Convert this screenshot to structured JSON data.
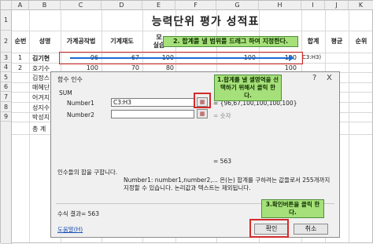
{
  "columns": [
    "A",
    "B",
    "C",
    "D",
    "E",
    "F",
    "G",
    "H",
    "I",
    "J",
    "K"
  ],
  "rows": [
    "1",
    "2",
    "3",
    "4",
    "5",
    "6",
    "7",
    "8",
    "9"
  ],
  "sheet_title": "능력단위 평가 성적표",
  "headers": {
    "seq": "순번",
    "name": "성명",
    "c": "가계공작법",
    "d": "기계재도",
    "e": "모\n실습",
    "total": "합계",
    "avg": "평균",
    "rank": "순위"
  },
  "r3": {
    "seq": "1",
    "name": "김기현",
    "c": "96",
    "d": "67",
    "e": "100",
    "g": "100",
    "h": "100",
    "total_formula": "C3:H3)"
  },
  "r4": {
    "seq": "2",
    "name": "호기수",
    "c": "100",
    "d": "70",
    "e": "80",
    "h": "100"
  },
  "names": {
    "r5": "김정스",
    "r6": "매혜단",
    "r7": "어겨지",
    "r8": "성지수",
    "r9": "박성지",
    "total": "총 계"
  },
  "callout2": "2. 합계를 낼 범위를 드래그 하여 지정한다.",
  "callout1": "1.합계를 낼 셀영역을 선택하기 위해서 클릭 한다.",
  "callout3": "3.확인버튼을 클릭 한다.",
  "dialog": {
    "title": "함수 인수",
    "help_btn": "?",
    "close_btn": "X",
    "func": "SUM",
    "number1_label": "Number1",
    "number1_value": "C3:H3",
    "number1_result": "= {96,67,100,100,100,100}",
    "number2_label": "Number2",
    "number2_result": "= 숫자",
    "preview": "= 563",
    "desc": "인수들의 합을 구합니다.",
    "arg_desc": "Number1:  number1,number2,... 은(는) 합계를 구하려는 값들로서 255개까지 지정할 수 있습니다. 논리값과 텍스트는 제외됩니다.",
    "formula_result": "수식 결과= 563",
    "help_link": "도움말(H)",
    "ok": "확인",
    "cancel": "취소"
  }
}
